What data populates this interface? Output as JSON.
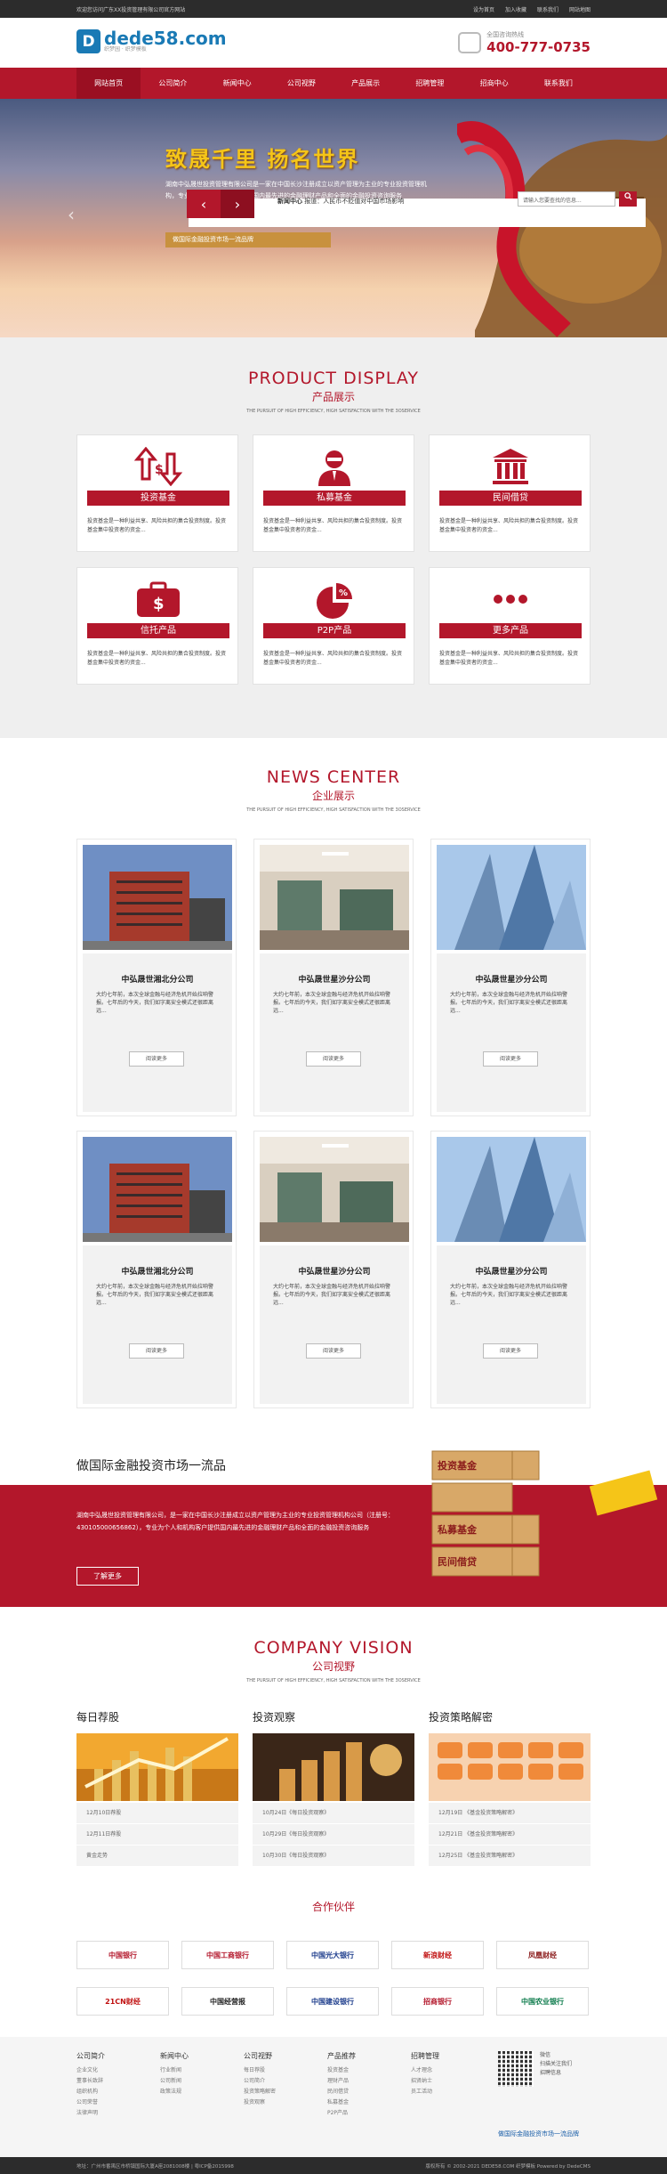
{
  "topbar": {
    "welcome": "欢迎您访问广东XX投资管理有限公司官方网站",
    "links": [
      "设为首页",
      "加入收藏",
      "联系我们",
      "网站地图"
    ]
  },
  "header": {
    "logo_mark": "D",
    "logo_text": "dede58.com",
    "logo_sub": "织梦园 · 织梦模板",
    "hotline_label": "全国咨询热线",
    "hotline": "400-777-0735"
  },
  "nav": {
    "items": [
      "网站首页",
      "公司简介",
      "新闻中心",
      "公司视野",
      "产品展示",
      "招聘管理",
      "招商中心",
      "联系我们"
    ],
    "active_index": 0
  },
  "banner": {
    "slogan": "致晟千里  扬名世界",
    "desc": "湖南中弘晟世投资管理有限公司是一家在中国长沙注册成立以资产管理为主业的专业投资管理机构，专业为个人和机构客户提供国内最先进的金融理财产品和全面的金融投资咨询服务",
    "tag": "做国际金融投资市场一流品牌",
    "news_label": "新闻中心",
    "news_text": "报道：人民币不贬值对中国市场影响",
    "search_placeholder": "请输入您要查找的信息...",
    "prev": "‹",
    "next": "›"
  },
  "products": {
    "title_en": "PRODUCT DISPLAY",
    "title_cn": "产品展示",
    "subtitle": "THE PURSUIT OF HIGH EFFICIENCY, HIGH SATISFACTION WITH THE 3OSERVICE",
    "items": [
      {
        "label": "投资基金",
        "icon": "exchange-arrows-icon",
        "desc": "投资基金是一种利益共享、风险共担的集合投资制度。投资基金集中投资者的资金..."
      },
      {
        "label": "私募基金",
        "icon": "businessman-icon",
        "desc": "投资基金是一种利益共享、风险共担的集合投资制度。投资基金集中投资者的资金..."
      },
      {
        "label": "民间借贷",
        "icon": "bank-icon",
        "desc": "投资基金是一种利益共享、风险共担的集合投资制度。投资基金集中投资者的资金..."
      },
      {
        "label": "信托产品",
        "icon": "briefcase-dollar-icon",
        "desc": "投资基金是一种利益共享、风险共担的集合投资制度。投资基金集中投资者的资金..."
      },
      {
        "label": "P2P产品",
        "icon": "pie-percent-icon",
        "desc": "投资基金是一种利益共享、风险共担的集合投资制度。投资基金集中投资者的资金..."
      },
      {
        "label": "更多产品",
        "icon": "more-dots-icon",
        "desc": "投资基金是一种利益共享、风险共担的集合投资制度。投资基金集中投资者的资金..."
      }
    ]
  },
  "news": {
    "title_en": "NEWS CENTER",
    "title_cn": "企业展示",
    "subtitle": "THE PURSUIT OF HIGH EFFICIENCY, HIGH SATISFACTION WITH THE 3OSERVICE",
    "more_label": "阅读更多",
    "items": [
      {
        "title": "中弘晟世湘北分公司",
        "desc": "大约七年前，本次全球金融与经济危机开始拉响警报。七年后的今天，我们如字离安全模式还很距离远...",
        "img": "red-office-building"
      },
      {
        "title": "中弘晟世星沙分公司",
        "desc": "大约七年前，本次全球金融与经济危机开始拉响警报。七年后的今天，我们如字离安全模式还很距离远...",
        "img": "office-interior"
      },
      {
        "title": "中弘晟世星沙分公司",
        "desc": "大约七年前，本次全球金融与经济危机开始拉响警报。七年后的今天，我们如字离安全模式还很距离远...",
        "img": "glass-skyscraper"
      },
      {
        "title": "中弘晟世湘北分公司",
        "desc": "大约七年前，本次全球金融与经济危机开始拉响警报。七年后的今天，我们如字离安全模式还很距离远...",
        "img": "red-office-building"
      },
      {
        "title": "中弘晟世星沙分公司",
        "desc": "大约七年前，本次全球金融与经济危机开始拉响警报。七年后的今天，我们如字离安全模式还很距离远...",
        "img": "office-interior"
      },
      {
        "title": "中弘晟世星沙分公司",
        "desc": "大约七年前，本次全球金融与经济危机开始拉响警报。七年后的今天，我们如字离安全模式还很距离远...",
        "img": "glass-skyscraper"
      }
    ]
  },
  "about": {
    "heading": "做国际金融投资市场一流品",
    "text": "湖南中弘晟世投资管理有限公司，是一家在中国长沙注册成立以资产管理为主业的专业投资管理机构公司（注册号：430105000656862），专业为个人和机构客户提供国内最先进的金融理财产品和全面的金融投资咨询服务",
    "button": "了解更多",
    "blocks": [
      "投资基金",
      "私募基金",
      "民间借贷"
    ]
  },
  "vision": {
    "title_en": "COMPANY VISION",
    "title_cn": "公司视野",
    "subtitle": "THE PURSUIT OF HIGH EFFICIENCY, HIGH SATISFACTION WITH THE 3OSERVICE",
    "columns": [
      {
        "title": "每日荐股",
        "items": [
          "12月10日荐股",
          "12月11日荐股",
          "黄金走势"
        ]
      },
      {
        "title": "投资观察",
        "items": [
          "10月24日《每日投资观察》",
          "10月29日《每日投资观察》",
          "10月30日《每日投资观察》"
        ]
      },
      {
        "title": "投资策略解密",
        "items": [
          "12月19日 《基金投资策略解密》",
          "12月21日 《基金投资策略解密》",
          "12月25日 《基金投资策略解密》"
        ]
      }
    ]
  },
  "partners": {
    "title": "合作伙伴",
    "logos": [
      "中国银行",
      "中国工商银行",
      "中国光大银行",
      "新浪财经",
      "凤凰财经",
      "21CN财经",
      "中国经营报",
      "中国建设银行",
      "招商银行",
      "中国农业银行"
    ]
  },
  "footer": {
    "columns": [
      {
        "title": "公司简介",
        "items": [
          "企业文化",
          "董事长致辞",
          "组织机构",
          "公司荣誉",
          "法律声明"
        ]
      },
      {
        "title": "新闻中心",
        "items": [
          "行业新闻",
          "公司新闻",
          "政策法规"
        ]
      },
      {
        "title": "公司视野",
        "items": [
          "每日荐股",
          "公司简介",
          "投资策略解密",
          "投资观察"
        ]
      },
      {
        "title": "产品推荐",
        "items": [
          "投资基金",
          "理财产品",
          "民间借贷",
          "私募基金",
          "P2P产品"
        ]
      },
      {
        "title": "招聘管理",
        "items": [
          "人才理念",
          "招贤纳士",
          "员工活动"
        ]
      }
    ],
    "qr_text": [
      "微信",
      "扫描关注我们",
      "招聘信息"
    ],
    "link": "做国际金融投资市场一流品牌"
  },
  "bottom": {
    "left": "地址：广州市番禺区市桥镇国际大厦A座2081008楼 | 粤ICP备2015998",
    "right": "版权所有 © 2002-2021 DEDE58.COM 织梦模板 Powered by DedeCMS"
  }
}
